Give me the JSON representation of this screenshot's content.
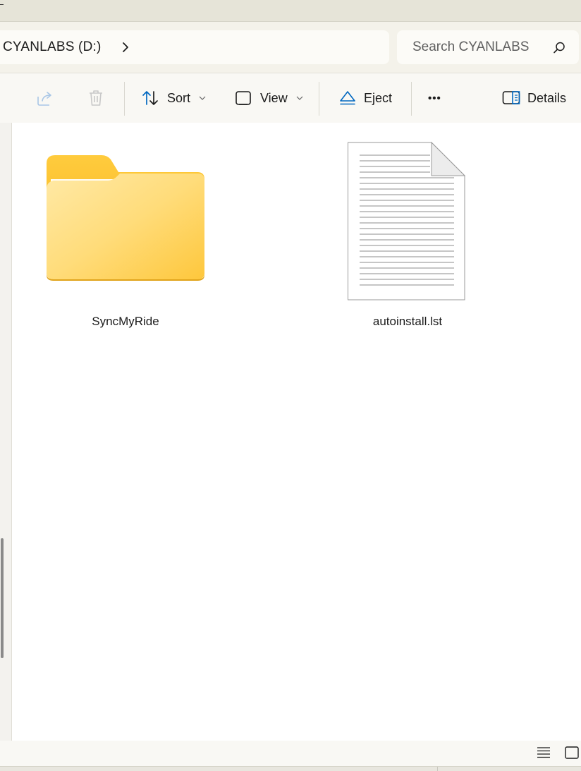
{
  "address": {
    "location": "CYANLABS (D:)",
    "chevron_icon": "chevron-right-icon"
  },
  "search": {
    "placeholder": "Search CYANLABS",
    "icon": "search-icon"
  },
  "toolbar": {
    "sort_label": "Sort",
    "view_label": "View",
    "eject_label": "Eject",
    "more_label": "•••",
    "details_label": "Details",
    "accent_color": "#0067c0"
  },
  "files": [
    {
      "name": "SyncMyRide",
      "type": "folder",
      "icon": "folder-icon"
    },
    {
      "name": "autoinstall.lst",
      "type": "file",
      "icon": "text-document-icon"
    }
  ],
  "statusbar": {
    "view_icons": [
      "details-view-icon",
      "tiles-view-icon"
    ]
  }
}
